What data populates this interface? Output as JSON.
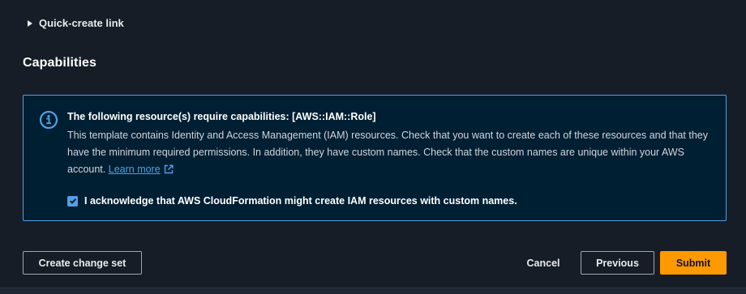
{
  "expander": {
    "label": "Quick-create link"
  },
  "section": {
    "title": "Capabilities"
  },
  "alert": {
    "header": "The following resource(s) require capabilities: [AWS::IAM::Role]",
    "body": "This template contains Identity and Access Management (IAM) resources. Check that you want to create each of these resources and that they have the minimum required permissions. In addition, they have custom names. Check that the custom names are unique within your AWS account.",
    "link_label": "Learn more",
    "icon": "info-circle-icon",
    "link_icon": "external-link-icon"
  },
  "acknowledge": {
    "label": "I acknowledge that AWS CloudFormation might create IAM resources with custom names.",
    "checked": true
  },
  "footer": {
    "create_change_set": "Create change set",
    "cancel": "Cancel",
    "previous": "Previous",
    "submit": "Submit"
  },
  "colors": {
    "background": "#161d26",
    "alert_bg": "#001f33",
    "alert_border": "#539fe5",
    "primary": "#ff9900"
  }
}
